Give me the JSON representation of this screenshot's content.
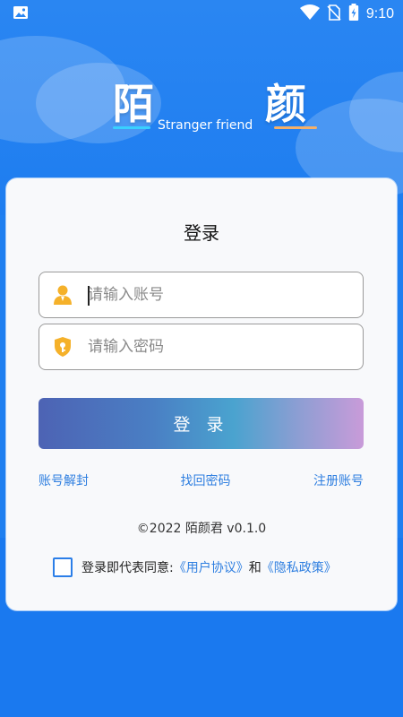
{
  "status_bar": {
    "time": "9:10",
    "icons": [
      "image-icon",
      "wifi-icon",
      "no-sim-icon",
      "battery-charging-icon"
    ]
  },
  "logo": {
    "char_1": "陌",
    "char_2": "颜",
    "subtitle": "Stranger friend"
  },
  "login": {
    "title": "登录",
    "account_placeholder": "请输入账号",
    "password_placeholder": "请输入密码",
    "submit_label": "登 录"
  },
  "links": {
    "unseal": "账号解封",
    "recover": "找回密码",
    "register": "注册账号"
  },
  "footer": {
    "copyright": "©2022 陌颜君 v0.1.0",
    "agree_prefix": "登录即代表同意:",
    "user_agreement": "《用户协议》",
    "and": "和",
    "privacy_policy": "《隐私政策》"
  },
  "colors": {
    "background": "#1f7ff0",
    "link": "#2f7fe0",
    "accent_icon": "#f5b12a"
  }
}
